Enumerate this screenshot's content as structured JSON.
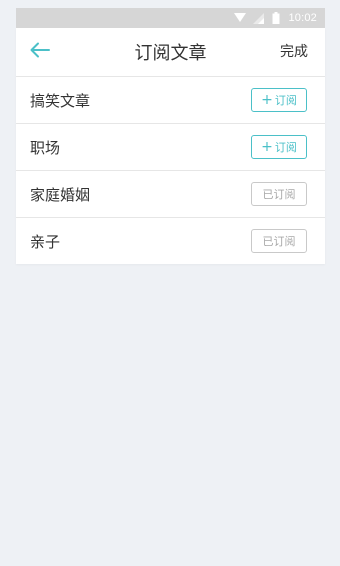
{
  "status_bar": {
    "time": "10:02",
    "background": "#d6d6d6"
  },
  "header": {
    "title": "订阅文章",
    "done_label": "完成",
    "back_icon": "arrow-left-icon",
    "accent": "#4bc0c8"
  },
  "items": [
    {
      "label": "搞笑文章",
      "button": "订阅",
      "subscribed": false,
      "button_icon": "plus-icon"
    },
    {
      "label": "职场",
      "button": "订阅",
      "subscribed": false,
      "button_icon": "plus-icon"
    },
    {
      "label": "家庭婚姻",
      "button": "已订阅",
      "subscribed": true
    },
    {
      "label": "亲子",
      "button": "已订阅",
      "subscribed": true
    }
  ]
}
